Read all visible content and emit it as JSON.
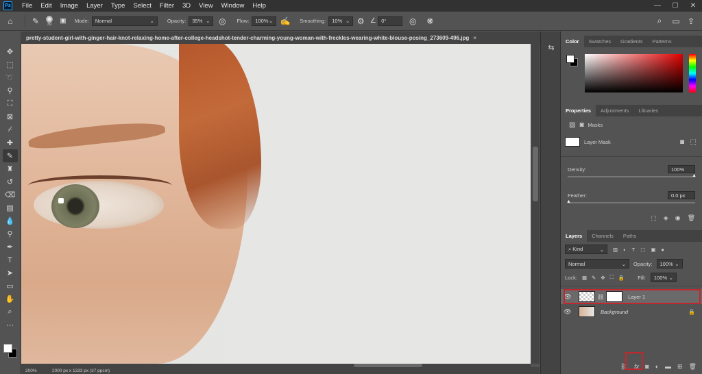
{
  "app": {
    "logo": "Ps"
  },
  "menu": [
    "File",
    "Edit",
    "Image",
    "Layer",
    "Type",
    "Select",
    "Filter",
    "3D",
    "View",
    "Window",
    "Help"
  ],
  "window_controls": [
    "—",
    "☐",
    "✕"
  ],
  "options": {
    "brush_size": "39",
    "mode_label": "Mode:",
    "mode_value": "Normal",
    "opacity_label": "Opacity:",
    "opacity_value": "35%",
    "flow_label": "Flow:",
    "flow_value": "100%",
    "smoothing_label": "Smoothing:",
    "smoothing_value": "10%",
    "angle_value": "0°"
  },
  "document": {
    "tab_title": "pretty-student-girl-with-ginger-hair-knot-relaxing-home-after-college-headshot-tender-charming-young-woman-with-freckles-wearing-white-blouse-posing_273609-496.jpg",
    "close_symbol": "×"
  },
  "status": {
    "zoom": "200%",
    "info": "2000 px x 1333 px (37 ppcm)"
  },
  "color_panel": {
    "tabs": [
      "Color",
      "Swatches",
      "Gradients",
      "Patterns"
    ]
  },
  "properties_panel": {
    "tabs": [
      "Properties",
      "Adjustments",
      "Libraries"
    ],
    "masks_label": "Masks",
    "layer_mask_label": "Layer Mask",
    "density_label": "Density:",
    "density_value": "100%",
    "feather_label": "Feather:",
    "feather_value": "0.0 px"
  },
  "layers_panel": {
    "tabs": [
      "Layers",
      "Channels",
      "Paths"
    ],
    "kind_label": "Kind",
    "blend_mode": "Normal",
    "opacity_label": "Opacity:",
    "opacity_value": "100%",
    "lock_label": "Lock:",
    "fill_label": "Fill:",
    "fill_value": "100%",
    "layers": [
      {
        "name": "Layer 1"
      },
      {
        "name": "Background"
      }
    ]
  },
  "colors": {
    "highlight": "#c4262e",
    "panel_bg": "#535353",
    "menubar_bg": "#323232"
  }
}
